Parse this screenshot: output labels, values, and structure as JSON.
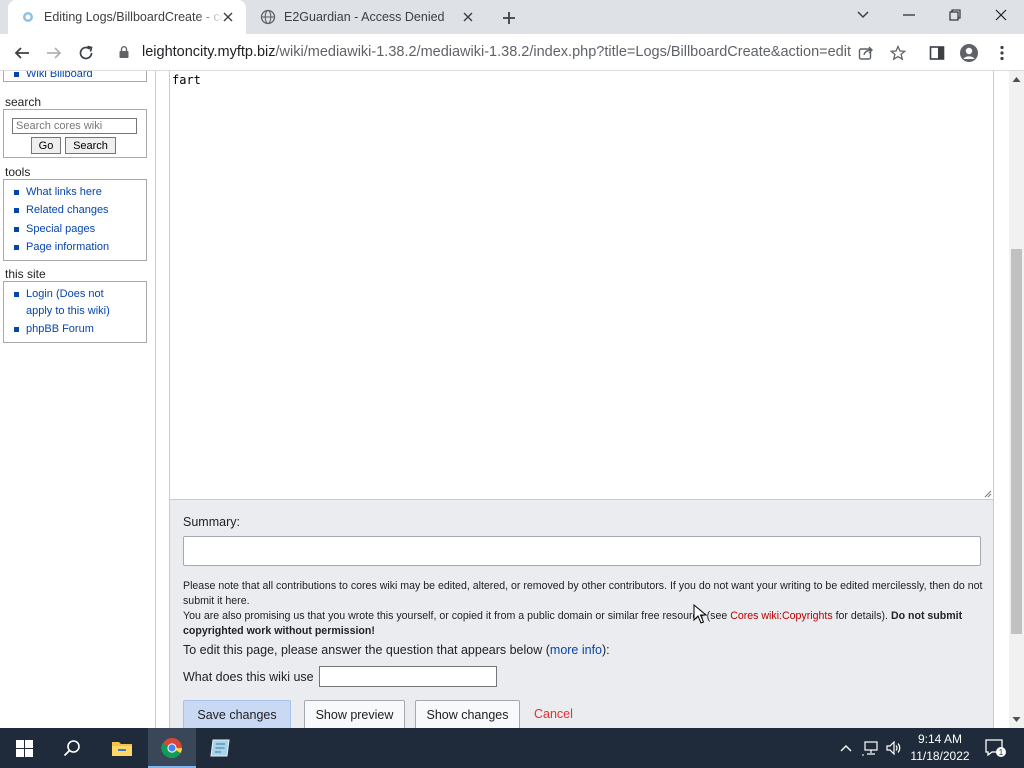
{
  "browser": {
    "tabs": [
      {
        "title": "Editing Logs/BillboardCreate - cores wiki",
        "active": true
      },
      {
        "title": "E2Guardian - Access Denied",
        "active": false
      }
    ],
    "address": {
      "host": "leightoncity.myftp.biz",
      "path": "/wiki/mediawiki-1.38.2/mediawiki-1.38.2/index.php?title=Logs/BillboardCreate&action=edit"
    }
  },
  "sidebar": {
    "top_link": "Wiki Billboard",
    "search": {
      "heading": "search",
      "placeholder": "Search cores wiki",
      "go_label": "Go",
      "search_label": "Search"
    },
    "tools": {
      "heading": "tools",
      "items": [
        "What links here",
        "Related changes",
        "Special pages",
        "Page information"
      ]
    },
    "this_site": {
      "heading": "this site",
      "login_line1": "Login (Does not",
      "login_line2": "apply to this wiki)",
      "forum": "phpBB Forum"
    }
  },
  "editor": {
    "content": "fart",
    "summary_label": "Summary:",
    "notice": {
      "p1": "Please note that all contributions to cores wiki may be edited, altered, or removed by other contributors. If you do not want your writing to be edited mercilessly, then do not submit it here.",
      "p2_pre": "You are also promising us that you wrote this yourself, or copied it from a public domain or similar free resource (see ",
      "p2_link": "Cores wiki:Copyrights",
      "p2_post": " for details). ",
      "p2_bold": "Do not submit copyrighted work without permission!"
    },
    "question_intro_pre": "To edit this page, please answer the question that appears below (",
    "question_intro_link": "more info",
    "question_intro_post": "):",
    "question_label": "What does this wiki use",
    "buttons": {
      "save": "Save changes",
      "preview": "Show preview",
      "changes": "Show changes",
      "cancel": "Cancel"
    }
  },
  "taskbar": {
    "time": "9:14 AM",
    "date": "11/18/2022",
    "notification_count": "1"
  },
  "colors": {
    "link": "#0645ad",
    "cancel": "#d33",
    "copyright_link": "#ba0000",
    "taskbar": "#1f2b3a"
  }
}
